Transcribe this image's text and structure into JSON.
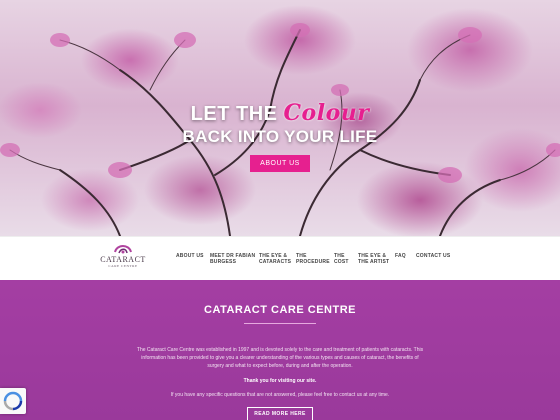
{
  "hero": {
    "line1_part1": "LET THE ",
    "line1_script": "Colour",
    "line2": "BACK INTO YOUR LIFE",
    "button_label": "ABOUT US"
  },
  "logo": {
    "title": "CATARACT",
    "subtitle": "CARE CENTRE"
  },
  "nav": {
    "items": [
      {
        "line1": "ABOUT US",
        "line2": ""
      },
      {
        "line1": "MEET DR FABIAN",
        "line2": "BURGESS"
      },
      {
        "line1": "THE EYE &",
        "line2": "CATARACTS"
      },
      {
        "line1": "THE",
        "line2": "PROCEDURE"
      },
      {
        "line1": "THE",
        "line2": "COST"
      },
      {
        "line1": "THE EYE &",
        "line2": "THE ARTIST"
      },
      {
        "line1": "FAQ",
        "line2": ""
      },
      {
        "line1": "CONTACT US",
        "line2": ""
      }
    ]
  },
  "content": {
    "title": "CATARACT CARE CENTRE",
    "paragraph": "The Cataract Care Centre was established in 1997 and is devoted solely to the care and treatment of patients with cataracts. This information has been provided to give you a clearer understanding of the various types and causes of cataract, the benefits of surgery and what to expect before, during and after the operation.",
    "thanks": "Thank you for visiting our site.",
    "question": "If you have any specific questions that are not answered, please feel free to contact us at any time.",
    "button_label": "READ MORE HERE"
  },
  "colors": {
    "accent_pink": "#e6208f",
    "section_purple": "#a43ea3"
  },
  "icons": {
    "recaptcha": "recaptcha-icon",
    "logo": "cataract-logo-icon"
  }
}
